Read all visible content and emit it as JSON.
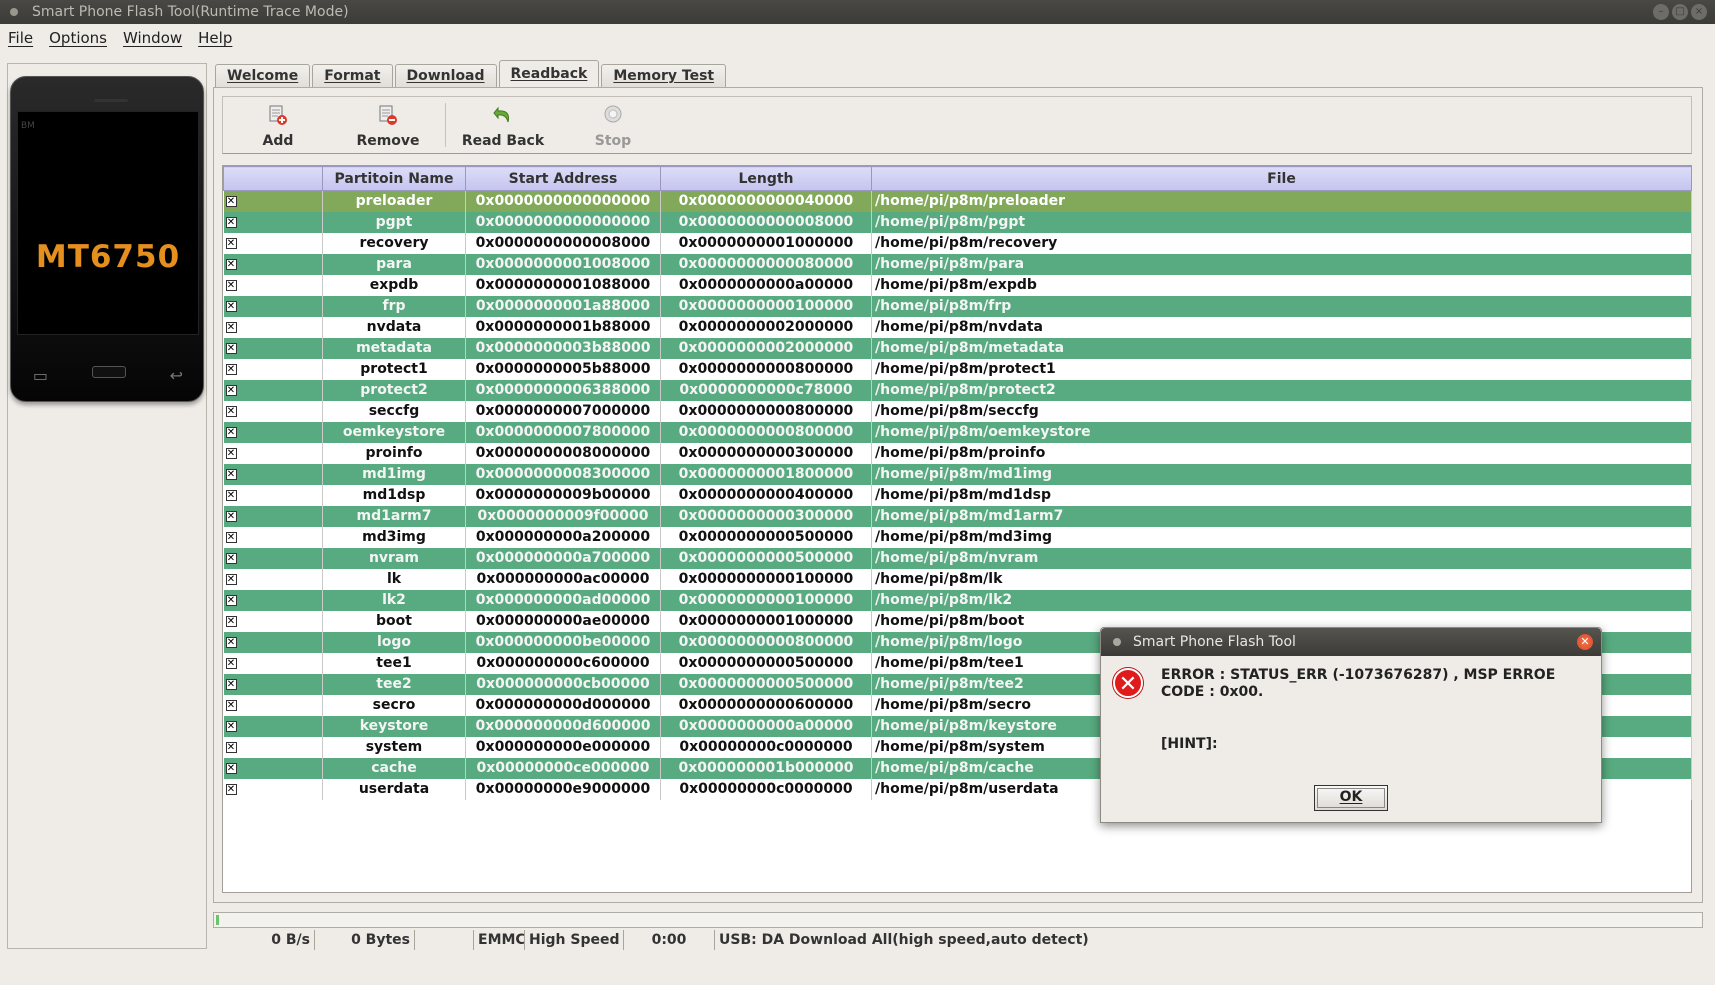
{
  "window": {
    "title": "Smart Phone Flash Tool(Runtime Trace Mode)"
  },
  "menu": [
    "File",
    "Options",
    "Window",
    "Help"
  ],
  "phone": {
    "model": "MT6750",
    "brand_mark": "BM"
  },
  "tabs": [
    "Welcome",
    "Format",
    "Download",
    "Readback",
    "Memory Test"
  ],
  "active_tab": "Readback",
  "toolbar": {
    "add_label": "Add",
    "remove_label": "Remove",
    "readback_label": "Read Back",
    "stop_label": "Stop"
  },
  "table": {
    "headers": [
      "",
      "Partitoin Name",
      "Start Address",
      "Length",
      "File"
    ],
    "rows": [
      {
        "name": "preloader",
        "start": "0x0000000000000000",
        "length": "0x0000000000040000",
        "file": "/home/pi/p8m/preloader"
      },
      {
        "name": "pgpt",
        "start": "0x0000000000000000",
        "length": "0x0000000000008000",
        "file": "/home/pi/p8m/pgpt"
      },
      {
        "name": "recovery",
        "start": "0x0000000000008000",
        "length": "0x0000000001000000",
        "file": "/home/pi/p8m/recovery"
      },
      {
        "name": "para",
        "start": "0x0000000001008000",
        "length": "0x0000000000080000",
        "file": "/home/pi/p8m/para"
      },
      {
        "name": "expdb",
        "start": "0x0000000001088000",
        "length": "0x0000000000a00000",
        "file": "/home/pi/p8m/expdb"
      },
      {
        "name": "frp",
        "start": "0x0000000001a88000",
        "length": "0x0000000000100000",
        "file": "/home/pi/p8m/frp"
      },
      {
        "name": "nvdata",
        "start": "0x0000000001b88000",
        "length": "0x0000000002000000",
        "file": "/home/pi/p8m/nvdata"
      },
      {
        "name": "metadata",
        "start": "0x0000000003b88000",
        "length": "0x0000000002000000",
        "file": "/home/pi/p8m/metadata"
      },
      {
        "name": "protect1",
        "start": "0x0000000005b88000",
        "length": "0x0000000000800000",
        "file": "/home/pi/p8m/protect1"
      },
      {
        "name": "protect2",
        "start": "0x0000000006388000",
        "length": "0x0000000000c78000",
        "file": "/home/pi/p8m/protect2"
      },
      {
        "name": "seccfg",
        "start": "0x0000000007000000",
        "length": "0x0000000000800000",
        "file": "/home/pi/p8m/seccfg"
      },
      {
        "name": "oemkeystore",
        "start": "0x0000000007800000",
        "length": "0x0000000000800000",
        "file": "/home/pi/p8m/oemkeystore"
      },
      {
        "name": "proinfo",
        "start": "0x0000000008000000",
        "length": "0x0000000000300000",
        "file": "/home/pi/p8m/proinfo"
      },
      {
        "name": "md1img",
        "start": "0x0000000008300000",
        "length": "0x0000000001800000",
        "file": "/home/pi/p8m/md1img"
      },
      {
        "name": "md1dsp",
        "start": "0x0000000009b00000",
        "length": "0x0000000000400000",
        "file": "/home/pi/p8m/md1dsp"
      },
      {
        "name": "md1arm7",
        "start": "0x0000000009f00000",
        "length": "0x0000000000300000",
        "file": "/home/pi/p8m/md1arm7"
      },
      {
        "name": "md3img",
        "start": "0x000000000a200000",
        "length": "0x0000000000500000",
        "file": "/home/pi/p8m/md3img"
      },
      {
        "name": "nvram",
        "start": "0x000000000a700000",
        "length": "0x0000000000500000",
        "file": "/home/pi/p8m/nvram"
      },
      {
        "name": "lk",
        "start": "0x000000000ac00000",
        "length": "0x0000000000100000",
        "file": "/home/pi/p8m/lk"
      },
      {
        "name": "lk2",
        "start": "0x000000000ad00000",
        "length": "0x0000000000100000",
        "file": "/home/pi/p8m/lk2"
      },
      {
        "name": "boot",
        "start": "0x000000000ae00000",
        "length": "0x0000000001000000",
        "file": "/home/pi/p8m/boot"
      },
      {
        "name": "logo",
        "start": "0x000000000be00000",
        "length": "0x0000000000800000",
        "file": "/home/pi/p8m/logo"
      },
      {
        "name": "tee1",
        "start": "0x000000000c600000",
        "length": "0x0000000000500000",
        "file": "/home/pi/p8m/tee1"
      },
      {
        "name": "tee2",
        "start": "0x000000000cb00000",
        "length": "0x0000000000500000",
        "file": "/home/pi/p8m/tee2"
      },
      {
        "name": "secro",
        "start": "0x000000000d000000",
        "length": "0x0000000000600000",
        "file": "/home/pi/p8m/secro"
      },
      {
        "name": "keystore",
        "start": "0x000000000d600000",
        "length": "0x0000000000a00000",
        "file": "/home/pi/p8m/keystore"
      },
      {
        "name": "system",
        "start": "0x000000000e000000",
        "length": "0x00000000c0000000",
        "file": "/home/pi/p8m/system"
      },
      {
        "name": "cache",
        "start": "0x00000000ce000000",
        "length": "0x000000001b000000",
        "file": "/home/pi/p8m/cache"
      },
      {
        "name": "userdata",
        "start": "0x00000000e9000000",
        "length": "0x00000000c0000000",
        "file": "/home/pi/p8m/userdata"
      }
    ]
  },
  "progress": {
    "percent": 0
  },
  "statusbar": {
    "speed": "0 B/s",
    "bytes": "0 Bytes",
    "blank": "",
    "storage": "EMMC",
    "speed_mode": "High Speed",
    "time": "0:00",
    "usb": "USB: DA Download All(high speed,auto detect)"
  },
  "dialog": {
    "title": "Smart Phone Flash Tool",
    "message": "ERROR : STATUS_ERR (-1073676287) , MSP ERROE CODE : 0x00.",
    "hint": "[HINT]:",
    "ok_label": "OK"
  },
  "colors": {
    "row_even": "#58ab80",
    "row_selected": "#82a95a",
    "header": "#c4c4ef",
    "error_red": "#e01b1b",
    "phone_model": "#e58f1f"
  }
}
